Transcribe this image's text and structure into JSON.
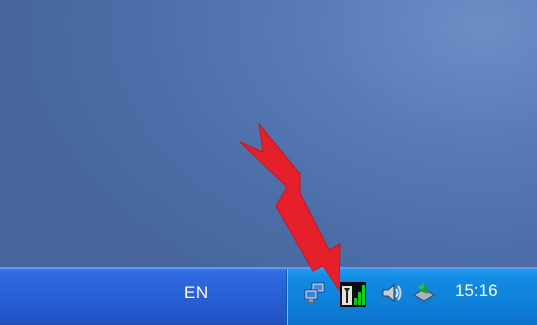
{
  "taskbar": {
    "language_indicator": "EN",
    "clock": "15:16"
  },
  "tray_icons": [
    "network-connections-icon",
    "signal-strength-icon",
    "volume-icon",
    "safely-remove-hardware-icon"
  ],
  "annotation": {
    "arrow_color": "#e6202b"
  },
  "colors": {
    "desktop": "#5577b3",
    "taskbar": "#2a62d8",
    "tray": "#0f80da"
  }
}
